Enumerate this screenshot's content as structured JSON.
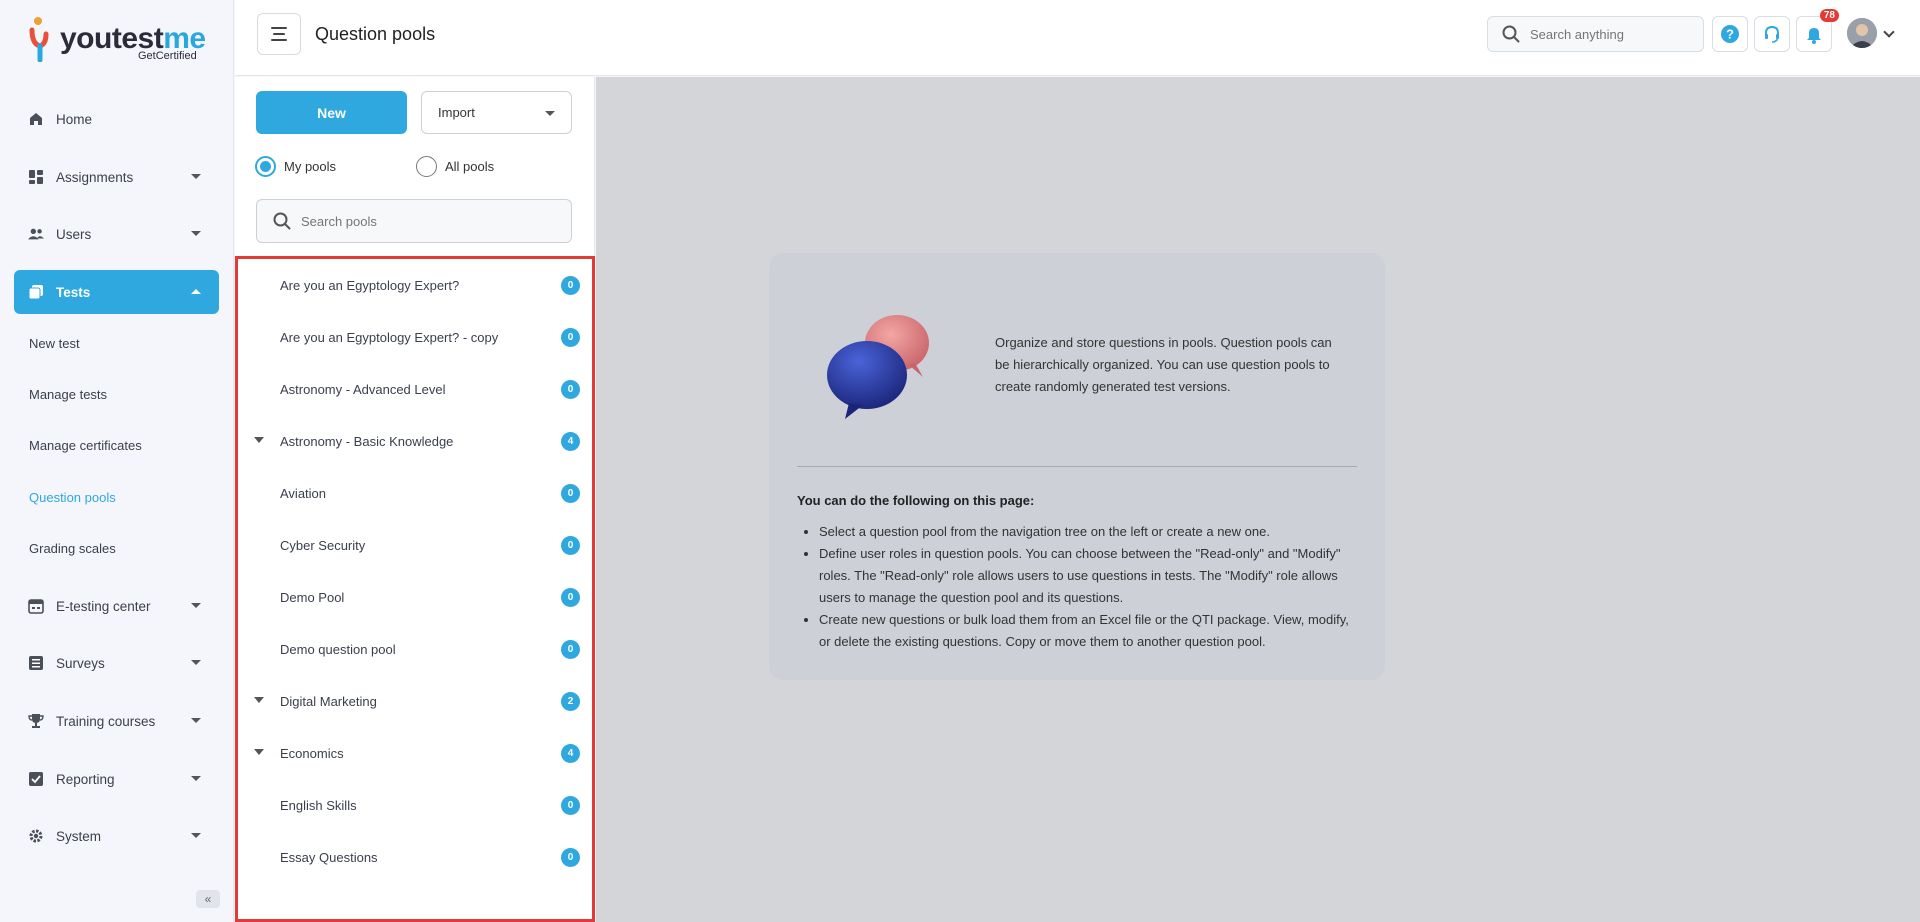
{
  "brand": {
    "name_part1": "youtest",
    "name_part2": "me",
    "tagline": "GetCertified"
  },
  "sidebar": {
    "items": [
      {
        "label": "Home"
      },
      {
        "label": "Assignments"
      },
      {
        "label": "Users"
      },
      {
        "label": "Tests"
      },
      {
        "label": "E-testing center"
      },
      {
        "label": "Surveys"
      },
      {
        "label": "Training courses"
      },
      {
        "label": "Reporting"
      },
      {
        "label": "System"
      }
    ],
    "tests_sub": [
      {
        "label": "New test"
      },
      {
        "label": "Manage tests"
      },
      {
        "label": "Manage certificates"
      },
      {
        "label": "Question pools"
      },
      {
        "label": "Grading scales"
      }
    ]
  },
  "header": {
    "title": "Question pools",
    "search_placeholder": "Search anything",
    "notifications_count": "78"
  },
  "left_pane": {
    "new_label": "New",
    "import_label": "Import",
    "radio_my": "My pools",
    "radio_all": "All pools",
    "search_placeholder": "Search pools",
    "pools": [
      {
        "name": "Are you an Egyptology Expert?",
        "count": "0",
        "expandable": false
      },
      {
        "name": "Are you an Egyptology Expert? - copy",
        "count": "0",
        "expandable": false
      },
      {
        "name": "Astronomy - Advanced Level",
        "count": "0",
        "expandable": false
      },
      {
        "name": "Astronomy - Basic Knowledge",
        "count": "4",
        "expandable": true
      },
      {
        "name": "Aviation",
        "count": "0",
        "expandable": false
      },
      {
        "name": "Cyber Security",
        "count": "0",
        "expandable": false
      },
      {
        "name": "Demo Pool",
        "count": "0",
        "expandable": false
      },
      {
        "name": "Demo question pool",
        "count": "0",
        "expandable": false
      },
      {
        "name": "Digital Marketing",
        "count": "2",
        "expandable": true
      },
      {
        "name": "Economics",
        "count": "4",
        "expandable": true
      },
      {
        "name": "English Skills",
        "count": "0",
        "expandable": false
      },
      {
        "name": "Essay Questions",
        "count": "0",
        "expandable": false
      }
    ]
  },
  "info": {
    "description": "Organize and store questions in pools. Question pools can be hierarchically organized. You can use question pools to create randomly generated test versions.",
    "heading": "You can do the following on this page:",
    "bullets": [
      "Select a question pool from the navigation tree on the left or create a new one.",
      "Define user roles in question pools. You can choose between the \"Read-only\" and \"Modify\" roles. The \"Read-only\" role allows users to use questions in tests. The \"Modify\" role allows users to manage the question pool and its questions.",
      "Create new questions or bulk load them from an Excel file or the QTI package. View, modify, or delete the existing questions. Copy or move them to another question pool."
    ]
  },
  "colors": {
    "accent": "#2fa8e0",
    "highlight_border": "#e53935",
    "badge": "#e53935"
  }
}
